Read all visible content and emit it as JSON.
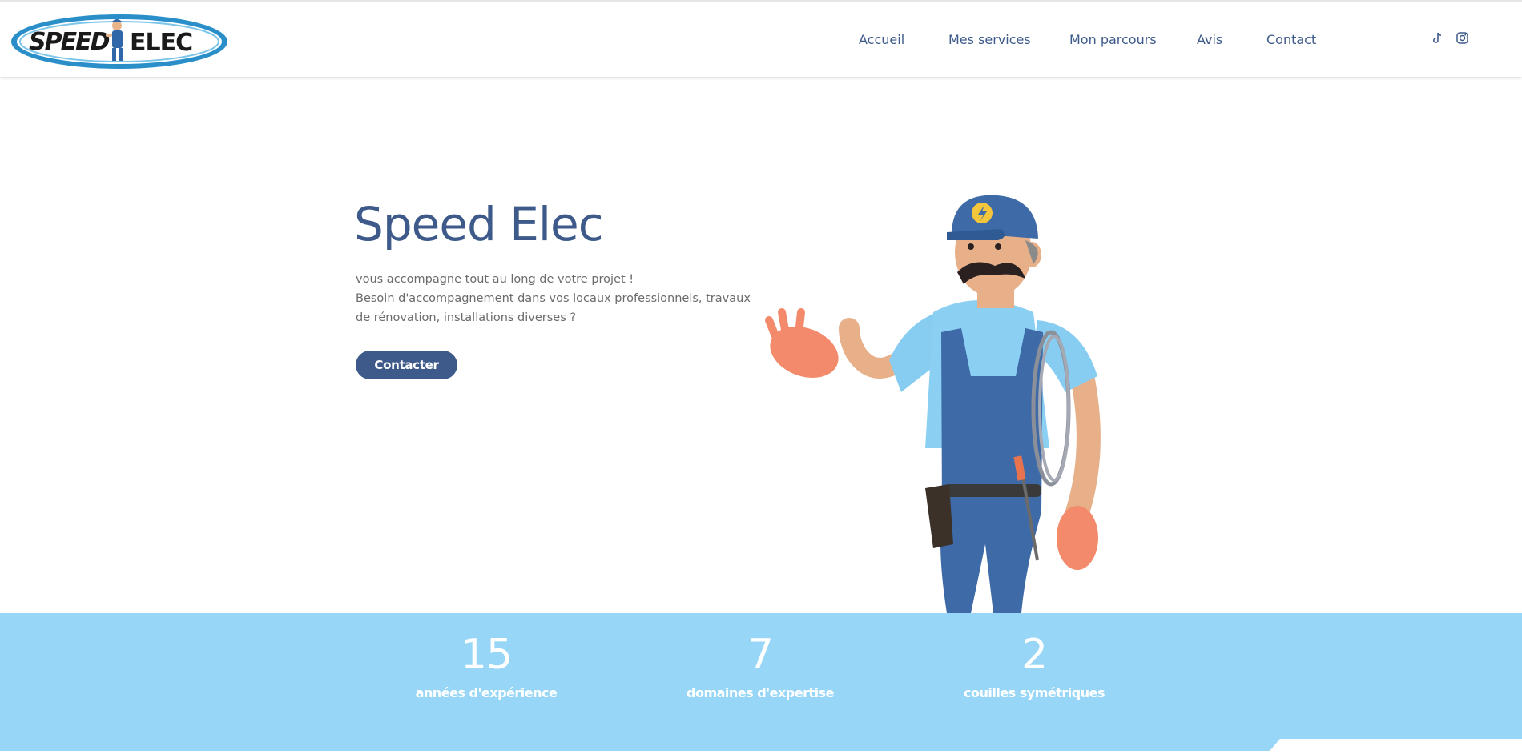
{
  "header": {
    "logo_alt": "SPEED ELEC",
    "nav": [
      {
        "label": "Accueil"
      },
      {
        "label": "Mes services"
      },
      {
        "label": "Mon parcours"
      },
      {
        "label": "Avis"
      },
      {
        "label": "Contact"
      }
    ],
    "social": [
      {
        "icon": "tiktok-icon"
      },
      {
        "icon": "instagram-icon"
      }
    ]
  },
  "hero": {
    "title": "Speed Elec",
    "line1": "vous accompagne tout au long de votre projet !",
    "line2": "Besoin d'accompagnement dans vos locaux professionnels, travaux de rénovation, installations diverses ?",
    "cta_label": "Contacter"
  },
  "stats": [
    {
      "value": "15",
      "label": "années d'expérience"
    },
    {
      "value": "7",
      "label": "domaines d'expertise"
    },
    {
      "value": "2",
      "label": "couilles symétriques"
    }
  ],
  "colors": {
    "brand": "#3d5a8a",
    "band": "#97d6f7",
    "text_muted": "#6b6b6b"
  }
}
